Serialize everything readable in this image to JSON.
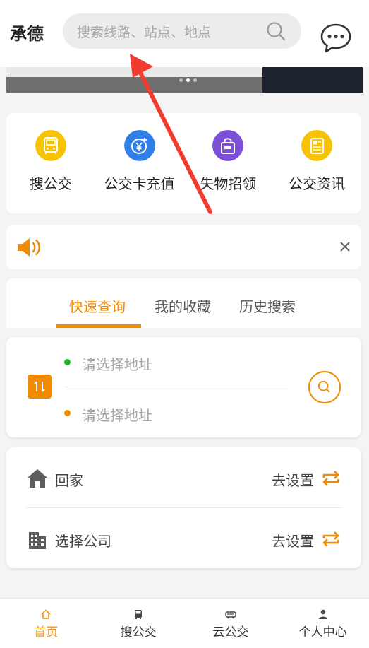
{
  "header": {
    "city": "承德",
    "search_placeholder": "搜索线路、站点、地点"
  },
  "quick_menu": [
    {
      "label": "搜公交",
      "icon": "bus-search-icon",
      "color": "#f7c200"
    },
    {
      "label": "公交卡充值",
      "icon": "yuan-recharge-icon",
      "color": "#2f7fe6"
    },
    {
      "label": "失物招领",
      "icon": "lost-found-bag-icon",
      "color": "#7d4fd8"
    },
    {
      "label": "公交资讯",
      "icon": "news-icon",
      "color": "#f7c200"
    }
  ],
  "notice": {
    "icon": "speaker-icon",
    "close_icon": "close-icon"
  },
  "tabs": [
    {
      "label": "快速查询",
      "active": true
    },
    {
      "label": "我的收藏",
      "active": false
    },
    {
      "label": "历史搜索",
      "active": false
    }
  ],
  "route": {
    "from_placeholder": "请选择地址",
    "to_placeholder": "请选择地址",
    "from_dot_color": "#1fb82f",
    "to_dot_color": "#f08a00"
  },
  "shortcuts": [
    {
      "label": "回家",
      "action": "去设置",
      "icon": "home-icon"
    },
    {
      "label": "选择公司",
      "action": "去设置",
      "icon": "building-icon"
    }
  ],
  "bottom_nav": [
    {
      "label": "首页",
      "icon": "home-nav-icon",
      "active": true
    },
    {
      "label": "搜公交",
      "icon": "bus-nav-icon",
      "active": false
    },
    {
      "label": "云公交",
      "icon": "cloud-bus-nav-icon",
      "active": false
    },
    {
      "label": "个人中心",
      "icon": "person-nav-icon",
      "active": false
    }
  ],
  "colors": {
    "accent": "#f08a00",
    "annotation_arrow": "#f23b2f"
  }
}
